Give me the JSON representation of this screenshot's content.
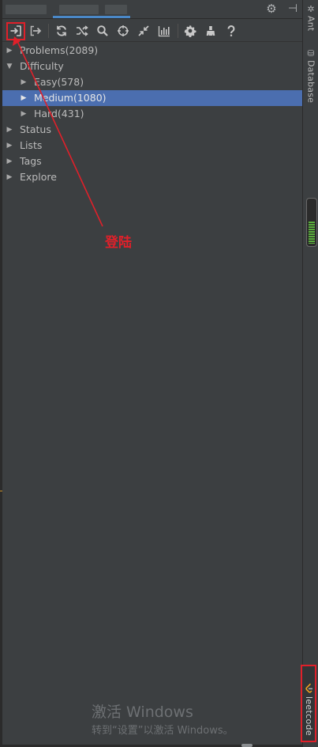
{
  "toolbar": {
    "icons": [
      "sign-in-icon",
      "sign-out-icon",
      "refresh-icon",
      "random-icon",
      "search-icon",
      "crosshair-icon",
      "collapse-icon",
      "chart-icon",
      "gear-icon",
      "clear-icon",
      "help-icon"
    ]
  },
  "tree": [
    {
      "label": "Problems(2089)",
      "level": 0,
      "expanded": false,
      "selected": false
    },
    {
      "label": "Difficulty",
      "level": 0,
      "expanded": true,
      "selected": false
    },
    {
      "label": "Easy(578)",
      "level": 1,
      "expanded": false,
      "selected": false
    },
    {
      "label": "Medium(1080)",
      "level": 1,
      "expanded": false,
      "selected": true
    },
    {
      "label": "Hard(431)",
      "level": 1,
      "expanded": false,
      "selected": false
    },
    {
      "label": "Status",
      "level": 0,
      "expanded": false,
      "selected": false
    },
    {
      "label": "Lists",
      "level": 0,
      "expanded": false,
      "selected": false
    },
    {
      "label": "Tags",
      "level": 0,
      "expanded": false,
      "selected": false
    },
    {
      "label": "Explore",
      "level": 0,
      "expanded": false,
      "selected": false
    }
  ],
  "right_strip": {
    "ant_label": "Ant",
    "database_label": "Database",
    "leetcode_label": "leetcode"
  },
  "annotation": {
    "label": "登陆",
    "color": "#e0202a"
  },
  "watermark": {
    "line1": "激活 Windows",
    "line2": "转到“设置”以激活 Windows。"
  },
  "colors": {
    "panel_bg": "#3c3f41",
    "selection": "#4b6eaf",
    "accent_underline": "#4a88c7",
    "annotation_red": "#e0202a",
    "memory_green": "#5aad3c"
  }
}
